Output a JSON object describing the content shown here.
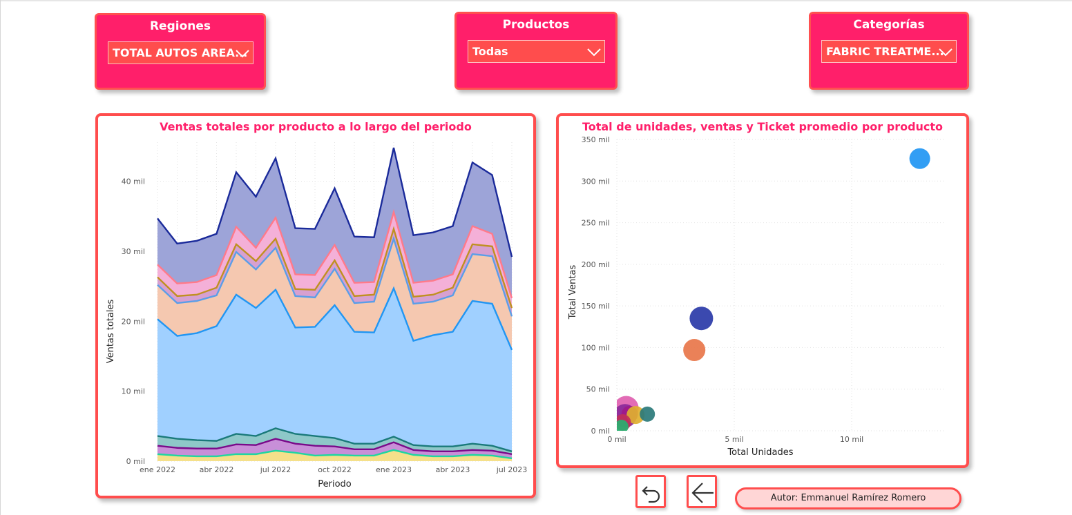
{
  "slicers": [
    {
      "title": "Regiones",
      "value": "TOTAL AUTOS AREA..."
    },
    {
      "title": "Productos",
      "value": "Todas"
    },
    {
      "title": "Categorías",
      "value": "FABRIC TREATME..."
    }
  ],
  "colors": {
    "slicer_bg": "#ff1f6a",
    "accent": "#ff4d4d",
    "title": "#ff1f6a"
  },
  "area_chart": {
    "title": "Ventas totales por producto a lo largo del periodo",
    "xlabel": "Periodo",
    "ylabel": "Ventas totales",
    "x_ticks": [
      "ene 2022",
      "abr 2022",
      "jul 2022",
      "oct 2022",
      "ene 2023",
      "abr 2023",
      "jul 2023"
    ],
    "y_ticks": [
      "0 mil",
      "10 mil",
      "20 mil",
      "30 mil",
      "40 mil"
    ]
  },
  "scatter_chart": {
    "title": "Total de unidades, ventas y Ticket promedio por producto",
    "xlabel": "Total Unidades",
    "ylabel": "Total Ventas",
    "x_ticks": [
      "0 mil",
      "5 mil",
      "10 mil"
    ],
    "y_ticks": [
      "0 mil",
      "50 mil",
      "100 mil",
      "150 mil",
      "200 mil",
      "250 mil",
      "300 mil",
      "350 mil"
    ]
  },
  "buttons": {
    "reset": "reset-icon",
    "back": "back-arrow-icon"
  },
  "author": "Autor: Emmanuel Ramírez Romero",
  "chart_data": [
    {
      "type": "area",
      "title": "Ventas totales por producto a lo largo del periodo",
      "xlabel": "Periodo",
      "ylabel": "Ventas totales",
      "ylim": [
        0,
        45
      ],
      "y_unit": "mil",
      "x": [
        "ene 2022",
        "feb 2022",
        "mar 2022",
        "abr 2022",
        "may 2022",
        "jun 2022",
        "jul 2022",
        "ago 2022",
        "sep 2022",
        "oct 2022",
        "nov 2022",
        "dic 2022",
        "ene 2023",
        "feb 2023",
        "mar 2023",
        "abr 2023",
        "may 2023",
        "jun 2023",
        "jul 2023"
      ],
      "cumulative_series": [
        {
          "color": "#f5e08a",
          "line": "#1fd6a0",
          "values": [
            1.0,
            0.8,
            0.7,
            0.7,
            1.0,
            1.0,
            1.5,
            1.2,
            0.8,
            0.9,
            0.8,
            0.8,
            1.6,
            0.9,
            0.7,
            0.7,
            0.9,
            0.8,
            0.4
          ]
        },
        {
          "color": "#c88fd8",
          "line": "#7a0a8a",
          "values": [
            2.2,
            1.9,
            1.8,
            1.8,
            2.4,
            2.3,
            3.2,
            2.5,
            2.2,
            2.1,
            1.7,
            1.7,
            2.7,
            1.6,
            1.4,
            1.4,
            1.6,
            1.5,
            1.0
          ]
        },
        {
          "color": "#8ec8c8",
          "line": "#1a7a7a",
          "values": [
            3.6,
            3.2,
            3.0,
            2.9,
            3.9,
            3.6,
            4.7,
            3.9,
            3.6,
            3.3,
            2.5,
            2.5,
            3.5,
            2.3,
            2.1,
            2.1,
            2.5,
            2.2,
            1.4
          ]
        },
        {
          "color": "#a0d0ff",
          "line": "#2196f3",
          "values": [
            20.3,
            17.9,
            18.3,
            19.3,
            23.8,
            21.9,
            24.5,
            19.1,
            19.2,
            22.3,
            18.5,
            18.4,
            24.7,
            17.2,
            18.0,
            18.5,
            22.9,
            22.5,
            15.9
          ]
        },
        {
          "color": "#f5c8b0",
          "line": "#5a9ee8",
          "values": [
            25.2,
            22.6,
            22.9,
            23.7,
            29.9,
            27.4,
            30.5,
            23.6,
            23.4,
            27.5,
            22.6,
            22.8,
            31.8,
            22.5,
            22.8,
            23.7,
            29.6,
            29.3,
            20.7
          ]
        },
        {
          "color": "#d7a0d0",
          "line": "#c09020",
          "values": [
            26.3,
            23.6,
            23.8,
            24.8,
            31.0,
            28.6,
            31.8,
            24.6,
            24.5,
            28.7,
            23.6,
            23.8,
            33.2,
            23.5,
            23.8,
            24.8,
            31.0,
            30.7,
            21.9
          ]
        },
        {
          "color": "#f4b0d8",
          "line": "#ff7a8a",
          "values": [
            28.1,
            25.4,
            25.6,
            26.6,
            33.5,
            30.5,
            34.8,
            26.7,
            26.6,
            30.9,
            25.5,
            25.6,
            35.6,
            25.5,
            25.8,
            26.7,
            33.6,
            32.5,
            23.3
          ]
        },
        {
          "color": "#9da4d8",
          "line": "#1a2a9a",
          "values": [
            34.7,
            31.1,
            31.5,
            32.5,
            41.3,
            37.8,
            43.3,
            33.3,
            33.2,
            39.0,
            32.1,
            32.0,
            44.8,
            32.3,
            32.7,
            33.6,
            42.7,
            40.9,
            29.2
          ]
        }
      ]
    },
    {
      "type": "scatter",
      "title": "Total de unidades, ventas y Ticket promedio por producto",
      "xlabel": "Total Unidades",
      "ylabel": "Total Ventas",
      "xlim": [
        0,
        14
      ],
      "ylim": [
        0,
        350
      ],
      "unit": "mil",
      "points": [
        {
          "x": 12.9,
          "y": 327,
          "color": "#2196f3",
          "size": 15
        },
        {
          "x": 3.6,
          "y": 135,
          "color": "#2a3aa8",
          "size": 17
        },
        {
          "x": 3.3,
          "y": 97,
          "color": "#e8764a",
          "size": 16
        },
        {
          "x": 0.4,
          "y": 27,
          "color": "#e060b0",
          "size": 18
        },
        {
          "x": 0.35,
          "y": 18,
          "color": "#8a2a9a",
          "size": 17
        },
        {
          "x": 0.55,
          "y": 20,
          "color": "#a01a8a",
          "size": 12
        },
        {
          "x": 0.8,
          "y": 19,
          "color": "#e0b030",
          "size": 13
        },
        {
          "x": 1.3,
          "y": 20,
          "color": "#2a7a7a",
          "size": 11
        },
        {
          "x": 0.25,
          "y": 10,
          "color": "#c0305a",
          "size": 12
        },
        {
          "x": 0.2,
          "y": 5,
          "color": "#28b070",
          "size": 10
        }
      ]
    }
  ]
}
